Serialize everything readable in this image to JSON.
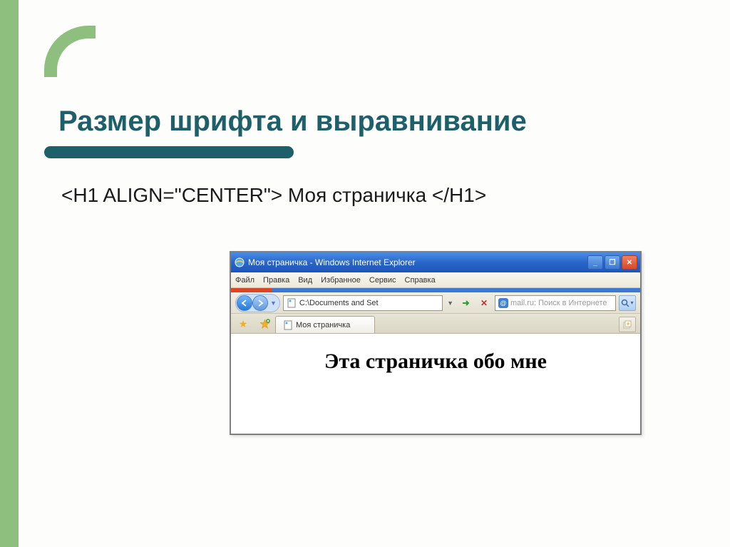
{
  "slide": {
    "title": "Размер шрифта и выравнивание",
    "code_example": "<H1 ALIGN=\"CENTER\"> Моя страничка </H1>"
  },
  "browser": {
    "window_title": "Моя страничка - Windows Internet Explorer",
    "menubar": {
      "file": "Файл",
      "edit": "Правка",
      "view": "Вид",
      "favorites": "Избранное",
      "tools": "Сервис",
      "help": "Справка"
    },
    "address": "C:\\Documents and Set",
    "search_placeholder": "mail.ru: Поиск в Интернете",
    "tab_title": "Моя страничка",
    "page_heading": "Эта страничка обо мне"
  }
}
